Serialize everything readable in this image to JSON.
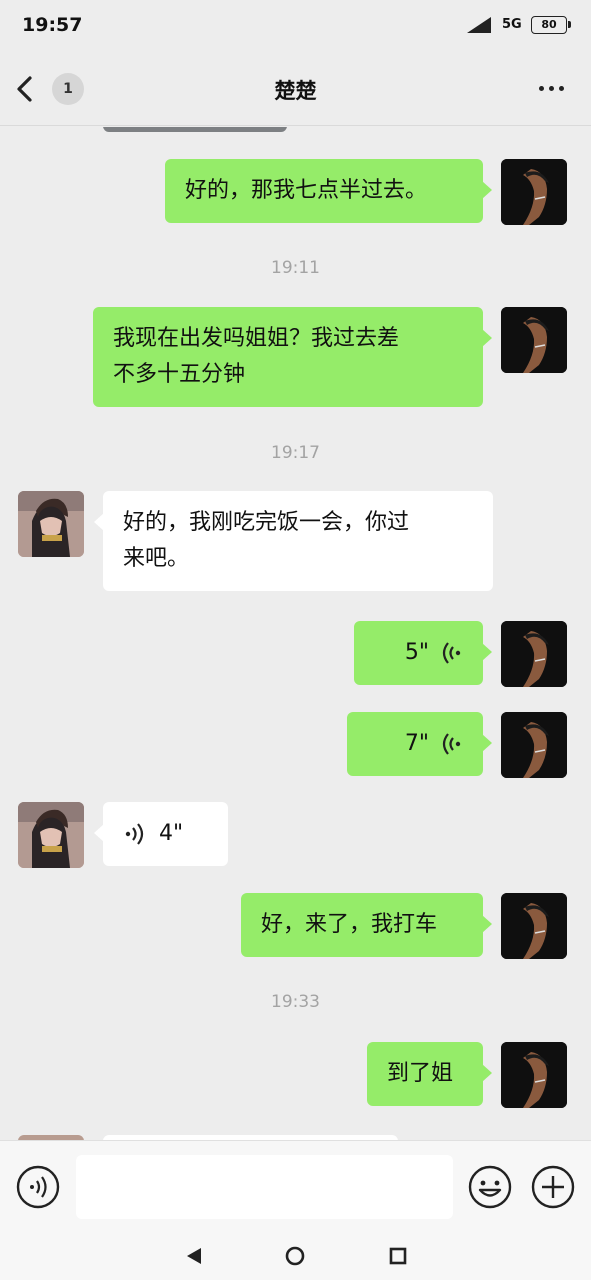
{
  "status_bar": {
    "time": "19:57",
    "network": "5G",
    "battery": "80"
  },
  "header": {
    "title": "楚楚",
    "unread_badge": "1",
    "back_icon": "chevron-left-icon",
    "more_icon": "more-dots-icon"
  },
  "messages": [
    {
      "type": "text",
      "from": "me",
      "text": "好的，那我七点半过去。"
    },
    {
      "type": "timestamp",
      "text": "19:11"
    },
    {
      "type": "text",
      "from": "me",
      "line1": "我现在出发吗姐姐？我过去差",
      "line2": "不多十五分钟"
    },
    {
      "type": "timestamp",
      "text": "19:17"
    },
    {
      "type": "text",
      "from": "her",
      "line1": "好的，我刚吃完饭一会，你过",
      "line2": "来吧。"
    },
    {
      "type": "voice",
      "from": "me",
      "duration": "5\""
    },
    {
      "type": "voice",
      "from": "me",
      "duration": "7\""
    },
    {
      "type": "voice",
      "from": "her",
      "duration": "4\""
    },
    {
      "type": "text",
      "from": "me",
      "text": "好，来了，我打车"
    },
    {
      "type": "timestamp",
      "text": "19:33"
    },
    {
      "type": "text",
      "from": "me",
      "text": "到了姐"
    }
  ],
  "input_bar": {
    "voice_icon": "voice-mode-icon",
    "text_value": "",
    "emoji_icon": "emoji-icon",
    "plus_icon": "plus-icon"
  },
  "nav_bar": {
    "back": "back-triangle-icon",
    "home": "home-circle-icon",
    "recents": "recents-square-icon"
  },
  "colors": {
    "outgoing_bubble": "#95ec69",
    "incoming_bubble": "#ffffff",
    "background": "#ededed"
  }
}
